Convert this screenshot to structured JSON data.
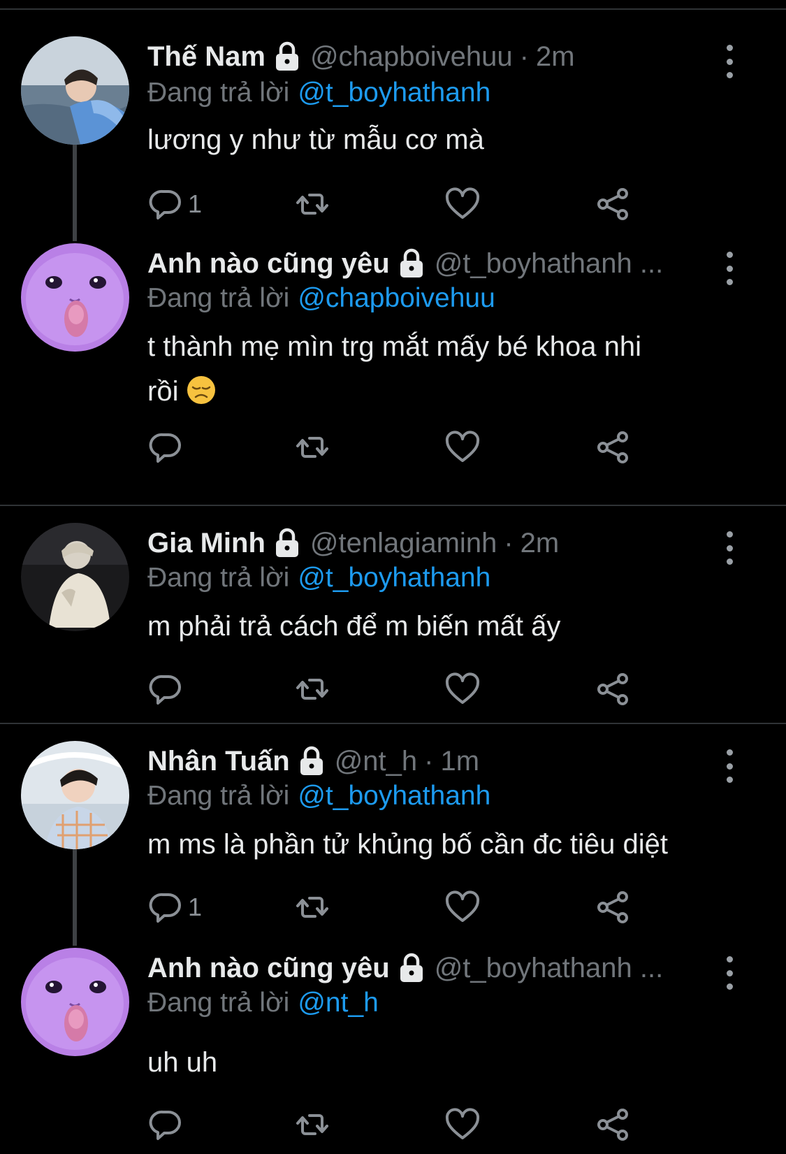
{
  "colors": {
    "background": "#000000",
    "text": "#e7e9ea",
    "muted": "#71767b",
    "accent": "#1d9bf0",
    "divider": "#2f3336"
  },
  "icons": {
    "lock": "lock-icon",
    "more": "more-vertical-icon",
    "reply": "reply-bubble-icon",
    "retweet": "retweet-icon",
    "like": "heart-icon",
    "share": "share-icon",
    "emoji": "disappointed-face-emoji"
  },
  "tweets": [
    {
      "name": "Thế Nam",
      "handle": "@chapboivehuu",
      "separator": "·",
      "time": "2m",
      "reply_prefix": "Đang trả lời",
      "reply_to": "@t_boyhathanh",
      "text": "lương y như từ mẫu cơ mà",
      "reply_count": "1"
    },
    {
      "name": "Anh nào cũng yêu",
      "handle": "@t_boyhathanh ...",
      "reply_prefix": "Đang trả lời",
      "reply_to": "@chapboivehuu",
      "text_line1": "t thành mẹ mìn trg mắt mấy bé khoa nhi",
      "text_line2": "rồi",
      "emoji": "😞"
    },
    {
      "name": "Gia Minh",
      "handle": "@tenlagiaminh",
      "separator": "·",
      "time": "2m",
      "reply_prefix": "Đang trả lời",
      "reply_to": "@t_boyhathanh",
      "text": "m phải trả cách để m biến mất ấy"
    },
    {
      "name": "Nhân Tuấn",
      "handle": "@nt_h",
      "separator": "·",
      "time": "1m",
      "reply_prefix": "Đang trả lời",
      "reply_to": "@t_boyhathanh",
      "text": "m ms là phần tử khủng bố cần đc tiêu diệt",
      "reply_count": "1"
    },
    {
      "name": "Anh nào cũng yêu",
      "handle": "@t_boyhathanh ...",
      "reply_prefix": "Đang trả lời",
      "reply_to": "@nt_h",
      "text": "uh uh"
    }
  ]
}
